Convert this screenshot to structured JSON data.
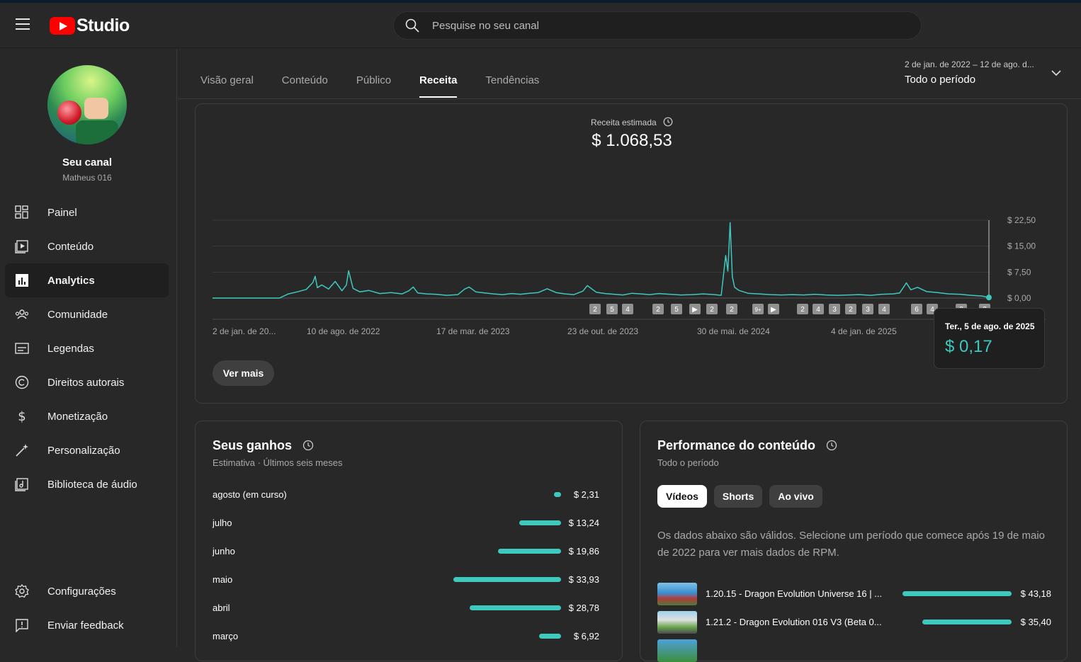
{
  "header": {
    "app_name": "Studio",
    "search_placeholder": "Pesquise no seu canal"
  },
  "channel": {
    "title": "Seu canal",
    "name": "Matheus 016"
  },
  "sidebar": {
    "items": [
      {
        "label": "Painel",
        "icon": "dashboard-icon"
      },
      {
        "label": "Conteúdo",
        "icon": "content-icon"
      },
      {
        "label": "Analytics",
        "icon": "analytics-icon"
      },
      {
        "label": "Comunidade",
        "icon": "community-icon"
      },
      {
        "label": "Legendas",
        "icon": "subtitles-icon"
      },
      {
        "label": "Direitos autorais",
        "icon": "copyright-icon"
      },
      {
        "label": "Monetização",
        "icon": "dollar-icon"
      },
      {
        "label": "Personalização",
        "icon": "magic-wand-icon"
      },
      {
        "label": "Biblioteca de áudio",
        "icon": "audio-library-icon"
      }
    ],
    "bottom": [
      {
        "label": "Configurações",
        "icon": "gear-icon"
      },
      {
        "label": "Enviar feedback",
        "icon": "feedback-icon"
      }
    ]
  },
  "tabs": [
    "Visão geral",
    "Conteúdo",
    "Público",
    "Receita",
    "Tendências"
  ],
  "active_tab": "Receita",
  "date_range": {
    "range": "2 de jan. de 2022 – 12 de ago. d...",
    "label": "Todo o período"
  },
  "revenue": {
    "label": "Receita estimada",
    "value": "$ 1.068,53",
    "see_more": "Ver mais",
    "tooltip_date": "Ter., 5 de ago. de 2025",
    "tooltip_value": "$ 0,17"
  },
  "chart_data": {
    "type": "line",
    "y_ticks": [
      "$ 22,50",
      "$ 15,00",
      "$ 7,50",
      "$ 0,00"
    ],
    "ylim": [
      0,
      22.5
    ],
    "x_ticks": [
      "2 de jan. de 20...",
      "10 de ago. de 2022",
      "17 de mar. de 2023",
      "23 de out. de 2023",
      "30 de mai. de 2024",
      "4 de jan. de 2025"
    ],
    "series": [
      {
        "color": "#3ec9be",
        "points": [
          [
            0,
            0
          ],
          [
            20,
            0
          ],
          [
            30,
            0
          ],
          [
            34,
            1.2
          ],
          [
            38,
            1.8
          ],
          [
            42,
            2.5
          ],
          [
            45,
            4.5
          ],
          [
            46,
            6.3
          ],
          [
            47,
            3
          ],
          [
            49,
            3.8
          ],
          [
            52,
            2.6
          ],
          [
            55,
            4.8
          ],
          [
            58,
            2.1
          ],
          [
            60,
            3.8
          ],
          [
            61,
            7.9
          ],
          [
            63,
            2.8
          ],
          [
            66,
            1.8
          ],
          [
            70,
            2.2
          ],
          [
            75,
            1.3
          ],
          [
            80,
            1.6
          ],
          [
            85,
            1.2
          ],
          [
            88,
            2.1
          ],
          [
            90,
            3.2
          ],
          [
            92,
            1.5
          ],
          [
            96,
            1.2
          ],
          [
            100,
            1.1
          ],
          [
            105,
            0.8
          ],
          [
            110,
            1.0
          ],
          [
            113,
            2.6
          ],
          [
            115,
            3.2
          ],
          [
            118,
            1.8
          ],
          [
            122,
            1.5
          ],
          [
            126,
            1.2
          ],
          [
            130,
            1.0
          ],
          [
            134,
            1.3
          ],
          [
            138,
            1.1
          ],
          [
            142,
            1.4
          ],
          [
            146,
            1.6
          ],
          [
            150,
            2.7
          ],
          [
            154,
            1.6
          ],
          [
            158,
            1.2
          ],
          [
            162,
            1.0
          ],
          [
            166,
            2.0
          ],
          [
            168,
            3.6
          ],
          [
            172,
            1.7
          ],
          [
            176,
            1.3
          ],
          [
            180,
            1.1
          ],
          [
            184,
            0.9
          ],
          [
            188,
            1.4
          ],
          [
            192,
            1.2
          ],
          [
            196,
            1.0
          ],
          [
            200,
            1.3
          ],
          [
            205,
            1.1
          ],
          [
            210,
            0.9
          ],
          [
            215,
            1.0
          ],
          [
            220,
            1.2
          ],
          [
            225,
            1.0
          ],
          [
            228,
            0.8
          ],
          [
            230,
            12.3
          ],
          [
            231,
            7.8
          ],
          [
            232,
            21.8
          ],
          [
            233,
            6.2
          ],
          [
            234,
            3.1
          ],
          [
            236,
            2.2
          ],
          [
            240,
            1.4
          ],
          [
            245,
            1.2
          ],
          [
            250,
            1.0
          ],
          [
            255,
            0.9
          ],
          [
            260,
            1.0
          ],
          [
            265,
            0.9
          ],
          [
            270,
            1.1
          ],
          [
            275,
            0.9
          ],
          [
            280,
            0.8
          ],
          [
            285,
            0.9
          ],
          [
            290,
            1.0
          ],
          [
            295,
            0.8
          ],
          [
            300,
            1.1
          ],
          [
            305,
            1.2
          ],
          [
            308,
            1.5
          ],
          [
            310,
            3.4
          ],
          [
            311,
            4.4
          ],
          [
            313,
            2.4
          ],
          [
            316,
            3.1
          ],
          [
            320,
            1.9
          ],
          [
            325,
            1.6
          ],
          [
            330,
            1.2
          ],
          [
            335,
            1.1
          ],
          [
            340,
            0.8
          ],
          [
            345,
            0.6
          ],
          [
            348,
            0.17
          ]
        ]
      }
    ],
    "x_domain": [
      0,
      348
    ],
    "markers": [
      "2",
      "5",
      "4",
      "2",
      "5",
      "▶",
      "2",
      "2",
      "9+",
      "▶",
      "2",
      "4",
      "3",
      "2",
      "3",
      "4",
      "6",
      "4",
      "2",
      "2"
    ]
  },
  "earnings": {
    "title": "Seus ganhos",
    "subtitle": "Estimativa · Últimos seis meses",
    "rows": [
      {
        "month": "agosto (em curso)",
        "value": 2.31,
        "label": "$ 2,31"
      },
      {
        "month": "julho",
        "value": 13.24,
        "label": "$ 13,24"
      },
      {
        "month": "junho",
        "value": 19.86,
        "label": "$ 19,86"
      },
      {
        "month": "maio",
        "value": 33.93,
        "label": "$ 33,93"
      },
      {
        "month": "abril",
        "value": 28.78,
        "label": "$ 28,78"
      },
      {
        "month": "março",
        "value": 6.92,
        "label": "$ 6,92"
      }
    ]
  },
  "performance": {
    "title": "Performance do conteúdo",
    "subtitle": "Todo o período",
    "chips": [
      "Vídeos",
      "Shorts",
      "Ao vivo"
    ],
    "note": "Os dados abaixo são válidos. Selecione um período que comece após 19 de maio de 2022 para ver mais dados de RPM.",
    "videos": [
      {
        "title": "1.20.15 - Dragon Evolution Universe 16 | ...",
        "value": 43.18,
        "label": "$ 43,18"
      },
      {
        "title": "1.21.2 - Dragon Evolution 016 V3 (Beta 0...",
        "value": 35.4,
        "label": "$ 35,40"
      }
    ]
  }
}
